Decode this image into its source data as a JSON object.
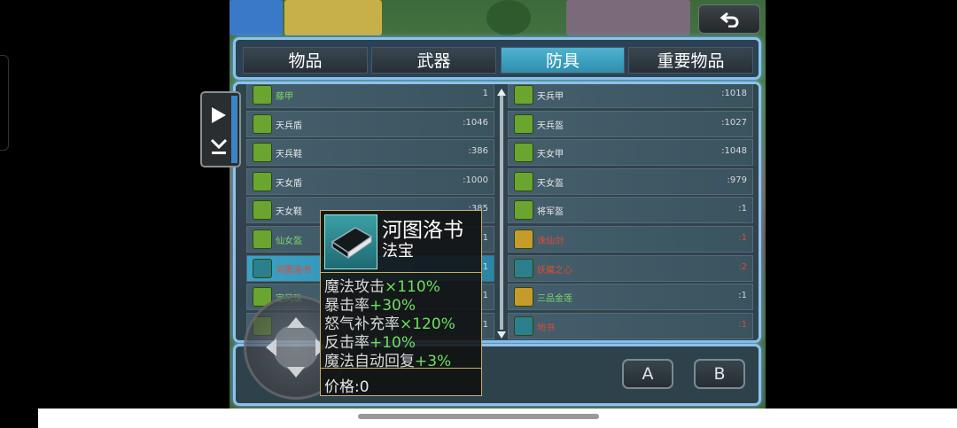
{
  "tabs": [
    {
      "label": "物品",
      "active": false
    },
    {
      "label": "武器",
      "active": false
    },
    {
      "label": "防具",
      "active": true
    },
    {
      "label": "重要物品",
      "active": false
    }
  ],
  "left_items": [
    {
      "name": "藤甲",
      "count": "1",
      "icon": "armor-icon",
      "name_color": "green"
    },
    {
      "name": "天兵盾",
      "count": ":1046",
      "icon": "shield-icon"
    },
    {
      "name": "天兵鞋",
      "count": ":386",
      "icon": "boots-icon"
    },
    {
      "name": "天女盾",
      "count": ":1000",
      "icon": "shield-icon"
    },
    {
      "name": "天女鞋",
      "count": ":385",
      "icon": "boots-icon"
    },
    {
      "name": "仙女盔",
      "count": "1",
      "icon": "helmet-icon",
      "name_color": "green"
    },
    {
      "name": "河图洛书",
      "count": "1",
      "icon": "book-icon",
      "selected": true,
      "name_color": "red"
    },
    {
      "name": "定风珠",
      "count": "1",
      "icon": "orb-icon",
      "name_color": "green"
    },
    {
      "name": "",
      "count": "1",
      "icon": "item-icon",
      "name_color": "green"
    }
  ],
  "right_items": [
    {
      "name": "天兵甲",
      "count": ":1018",
      "icon": "armor-icon"
    },
    {
      "name": "天兵盔",
      "count": ":1027",
      "icon": "helmet-icon"
    },
    {
      "name": "天女甲",
      "count": ":1048",
      "icon": "armor-icon"
    },
    {
      "name": "天女盔",
      "count": ":979",
      "icon": "helmet-icon"
    },
    {
      "name": "将军盔",
      "count": ":1",
      "icon": "helmet-icon"
    },
    {
      "name": "诛仙剑",
      "count": ":1",
      "icon": "sword-icon",
      "name_color": "red",
      "count_color": "red"
    },
    {
      "name": "妖魔之心",
      "count": ":2",
      "icon": "book-icon",
      "name_color": "red",
      "count_color": "red"
    },
    {
      "name": "三品金莲",
      "count": ":1",
      "icon": "lotus-icon",
      "name_color": "green"
    },
    {
      "name": "地书",
      "count": ":1",
      "icon": "book-icon",
      "name_color": "red",
      "count_color": "red"
    }
  ],
  "tooltip": {
    "title": "河图洛书",
    "type": "法宝",
    "icon": "book-icon",
    "stats": [
      {
        "label": "魔法攻击",
        "value": "×110%"
      },
      {
        "label": "暴击率",
        "value": "+30%"
      },
      {
        "label": "怒气补充率",
        "value": "×120%"
      },
      {
        "label": "反击率",
        "value": "+10%"
      },
      {
        "label": "魔法自动回复",
        "value": "+3%"
      }
    ],
    "price": "价格:0"
  },
  "buttons": {
    "a": "A",
    "b": "B"
  },
  "side_menu": {
    "expand_label": "开始",
    "collapse_label": "展开"
  },
  "colors": {
    "panel_border": "#8ec1ef",
    "active_tab": "#3ba2c6",
    "stat_value": "#6be05f",
    "rare_name": "#e04a36"
  }
}
